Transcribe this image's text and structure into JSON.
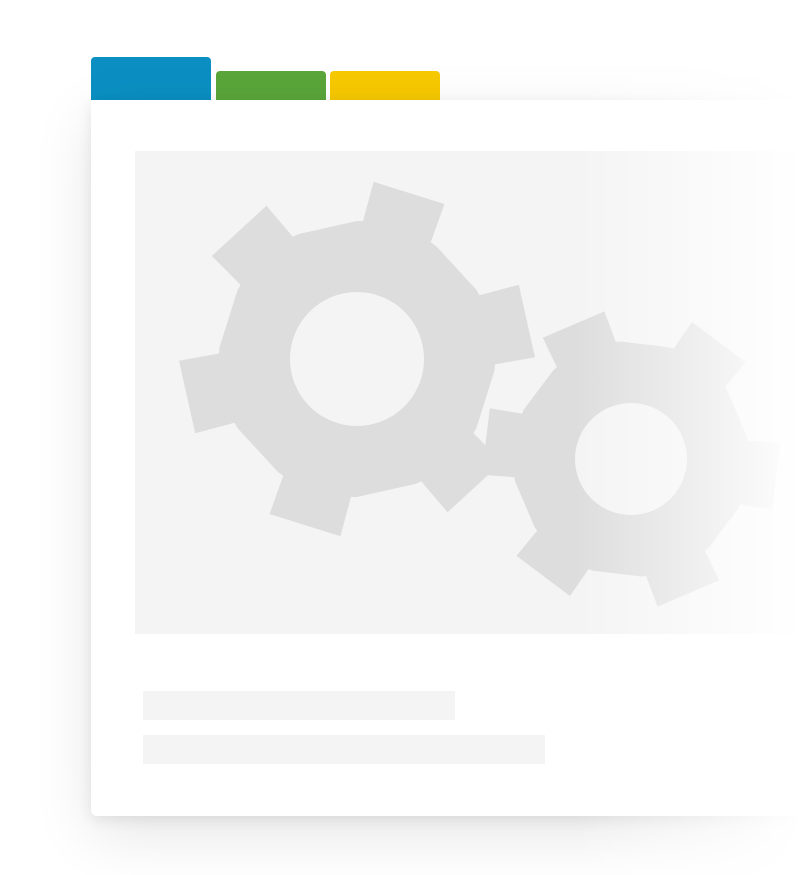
{
  "tabs": [
    {
      "label": "",
      "color": "#0b8fc2",
      "state": "active"
    },
    {
      "label": "",
      "color": "#5aa63a",
      "state": "inactive"
    },
    {
      "label": "",
      "color": "#f7c900",
      "state": "inactive"
    }
  ],
  "placeholder": {
    "image_icon": "gears-icon",
    "text_lines": 2
  },
  "colors": {
    "card": "#ffffff",
    "placeholder": "#f4f4f4",
    "gear": "#dddddd"
  }
}
